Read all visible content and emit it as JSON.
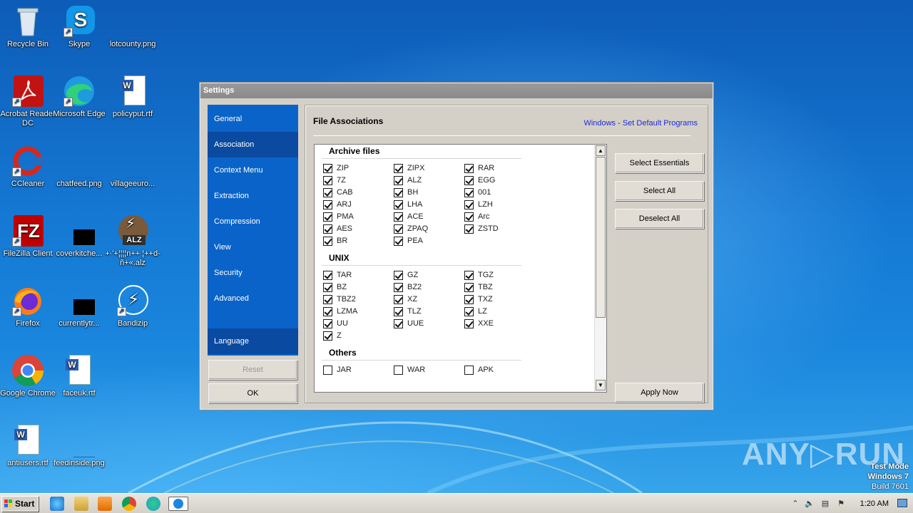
{
  "desktop": {
    "icons": [
      {
        "label": "Recycle Bin"
      },
      {
        "label": "Skype"
      },
      {
        "label": "lotcounty.png"
      },
      {
        "label": "Acrobat Reader DC"
      },
      {
        "label": "Microsoft Edge"
      },
      {
        "label": "policyput.rtf"
      },
      {
        "label": "CCleaner"
      },
      {
        "label": "chatfeed.png"
      },
      {
        "label": "villageeuro..."
      },
      {
        "label": "FileZilla Client"
      },
      {
        "label": "coverkitche..."
      },
      {
        "label": "+·'+¦¦¦¦n++ ¦++d-ñ+«.alz"
      },
      {
        "label": "Firefox"
      },
      {
        "label": "currentlytr..."
      },
      {
        "label": "Bandizip"
      },
      {
        "label": "Google Chrome"
      },
      {
        "label": "faceuk.rtf"
      },
      {
        "label": "antiusers.rtf"
      },
      {
        "label": "feedinside.png"
      }
    ],
    "alz_badge": "ALZ",
    "test_mode": {
      "line1": "Test Mode",
      "line2": "Windows 7",
      "line3": "Build 7601"
    },
    "watermark": "ANY▷RUN"
  },
  "window": {
    "title": "Settings",
    "nav": [
      {
        "label": "General"
      },
      {
        "label": "Association"
      },
      {
        "label": "Context Menu"
      },
      {
        "label": "Extraction"
      },
      {
        "label": "Compression"
      },
      {
        "label": "View"
      },
      {
        "label": "Security"
      },
      {
        "label": "Advanced"
      },
      {
        "label": "Language"
      }
    ],
    "reset_label": "Reset",
    "ok_label": "OK",
    "panel_title": "File Associations",
    "default_programs_link": "Windows - Set Default Programs",
    "select_essentials_label": "Select Essentials",
    "select_all_label": "Select All",
    "deselect_all_label": "Deselect All",
    "apply_now_label": "Apply Now",
    "groups": [
      {
        "title": "Archive files",
        "items": [
          {
            "label": "ZIP",
            "checked": true
          },
          {
            "label": "ZIPX",
            "checked": true
          },
          {
            "label": "RAR",
            "checked": true
          },
          {
            "label": "7Z",
            "checked": true
          },
          {
            "label": "ALZ",
            "checked": true
          },
          {
            "label": "EGG",
            "checked": true
          },
          {
            "label": "CAB",
            "checked": true
          },
          {
            "label": "BH",
            "checked": true
          },
          {
            "label": "001",
            "checked": true
          },
          {
            "label": "ARJ",
            "checked": true
          },
          {
            "label": "LHA",
            "checked": true
          },
          {
            "label": "LZH",
            "checked": true
          },
          {
            "label": "PMA",
            "checked": true
          },
          {
            "label": "ACE",
            "checked": true
          },
          {
            "label": "Arc",
            "checked": true
          },
          {
            "label": "AES",
            "checked": true
          },
          {
            "label": "ZPAQ",
            "checked": true
          },
          {
            "label": "ZSTD",
            "checked": true
          },
          {
            "label": "BR",
            "checked": true
          },
          {
            "label": "PEA",
            "checked": true
          }
        ]
      },
      {
        "title": "UNIX",
        "items": [
          {
            "label": "TAR",
            "checked": true
          },
          {
            "label": "GZ",
            "checked": true
          },
          {
            "label": "TGZ",
            "checked": true
          },
          {
            "label": "BZ",
            "checked": true
          },
          {
            "label": "BZ2",
            "checked": true
          },
          {
            "label": "TBZ",
            "checked": true
          },
          {
            "label": "TBZ2",
            "checked": true
          },
          {
            "label": "XZ",
            "checked": true
          },
          {
            "label": "TXZ",
            "checked": true
          },
          {
            "label": "LZMA",
            "checked": true
          },
          {
            "label": "TLZ",
            "checked": true
          },
          {
            "label": "LZ",
            "checked": true
          },
          {
            "label": "UU",
            "checked": true
          },
          {
            "label": "UUE",
            "checked": true
          },
          {
            "label": "XXE",
            "checked": true
          },
          {
            "label": "Z",
            "checked": true
          }
        ]
      },
      {
        "title": "Others",
        "items": [
          {
            "label": "JAR",
            "checked": false
          },
          {
            "label": "WAR",
            "checked": false
          },
          {
            "label": "APK",
            "checked": false
          }
        ]
      }
    ]
  },
  "taskbar": {
    "start_label": "Start",
    "time": "1:20 AM"
  }
}
